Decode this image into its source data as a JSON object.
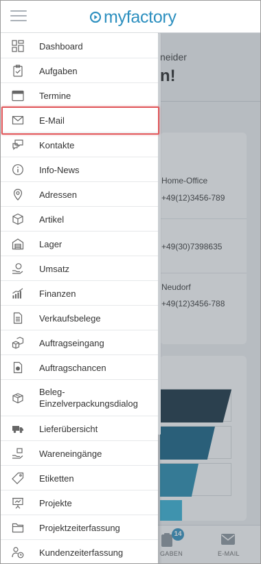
{
  "app": {
    "logo_text": "myfactory",
    "brand_color": "#2c8fbf"
  },
  "background": {
    "greeting_sub": "neider",
    "greeting_main": "n!",
    "contacts": [
      {
        "line1": "Home-Office",
        "line2": "+49(12)3456-789"
      },
      {
        "line1": "",
        "line2": "+49(30)7398635"
      },
      {
        "line1": "Neudorf",
        "line2": "+49(12)3456-788"
      }
    ]
  },
  "bottom_nav": {
    "items": [
      {
        "label": "GABEN",
        "icon": "clipboard-icon",
        "badge": "14"
      },
      {
        "label": "E-MAIL",
        "icon": "envelope-icon"
      }
    ]
  },
  "menu": {
    "items": [
      {
        "label": "Dashboard",
        "icon": "dashboard-icon"
      },
      {
        "label": "Aufgaben",
        "icon": "clipboard-check-icon"
      },
      {
        "label": "Termine",
        "icon": "calendar-icon"
      },
      {
        "label": "E-Mail",
        "icon": "envelope-icon"
      },
      {
        "label": "Kontakte",
        "icon": "chat-bubbles-icon"
      },
      {
        "label": "Info-News",
        "icon": "info-icon"
      },
      {
        "label": "Adressen",
        "icon": "map-pin-icon"
      },
      {
        "label": "Artikel",
        "icon": "box-icon"
      },
      {
        "label": "Lager",
        "icon": "warehouse-icon"
      },
      {
        "label": "Umsatz",
        "icon": "money-hand-icon"
      },
      {
        "label": "Finanzen",
        "icon": "chart-growth-icon"
      },
      {
        "label": "Verkaufsbelege",
        "icon": "document-icon"
      },
      {
        "label": "Auftragseingang",
        "icon": "boxes-icon"
      },
      {
        "label": "Auftragschancen",
        "icon": "document-chart-icon"
      },
      {
        "label": "Beleg-Einzelverpackungsdialog",
        "line1": "Beleg-",
        "line2": "Einzelverpackungsdialog",
        "icon": "package-open-icon"
      },
      {
        "label": "Lieferübersicht",
        "icon": "truck-icon"
      },
      {
        "label": "Wareneingänge",
        "icon": "hand-box-icon"
      },
      {
        "label": "Etiketten",
        "icon": "tag-icon"
      },
      {
        "label": "Projekte",
        "icon": "presentation-icon"
      },
      {
        "label": "Projektzeiterfassung",
        "icon": "folder-icon"
      },
      {
        "label": "Kundenzeiterfassung",
        "icon": "person-clock-icon"
      }
    ]
  }
}
